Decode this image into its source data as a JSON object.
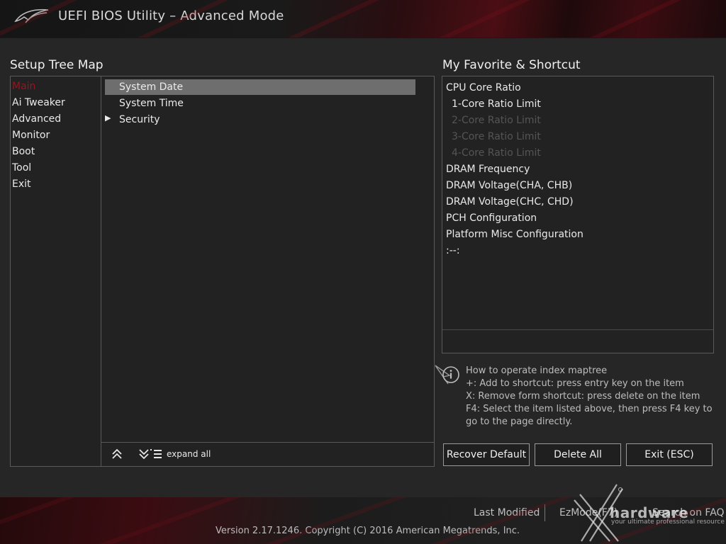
{
  "header": {
    "title": "UEFI BIOS Utility – Advanced Mode"
  },
  "tree": {
    "title": "Setup Tree Map",
    "menu": [
      {
        "label": "Main",
        "active": true
      },
      {
        "label": "Ai Tweaker"
      },
      {
        "label": "Advanced"
      },
      {
        "label": "Monitor"
      },
      {
        "label": "Boot"
      },
      {
        "label": "Tool"
      },
      {
        "label": "Exit"
      }
    ],
    "items": [
      {
        "label": "System Date",
        "selected": true
      },
      {
        "label": "System Time"
      },
      {
        "label": "Security",
        "expandable": true
      }
    ],
    "toolbar": {
      "expand_all": "expand all"
    }
  },
  "favorites": {
    "title": "My Favorite & Shortcut",
    "items": [
      {
        "label": "CPU Core Ratio"
      },
      {
        "label": "1-Core Ratio Limit",
        "sub": true
      },
      {
        "label": "2-Core Ratio Limit",
        "sub": true,
        "disabled": true
      },
      {
        "label": "3-Core Ratio Limit",
        "sub": true,
        "disabled": true
      },
      {
        "label": "4-Core Ratio Limit",
        "sub": true,
        "disabled": true
      },
      {
        "label": "DRAM Frequency"
      },
      {
        "label": "DRAM Voltage(CHA, CHB)"
      },
      {
        "label": "DRAM Voltage(CHC, CHD)"
      },
      {
        "label": "PCH Configuration"
      },
      {
        "label": "Platform Misc Configuration"
      },
      {
        "label": ":--:"
      }
    ]
  },
  "help": {
    "lines": [
      "How to operate index maptree",
      "+: Add to shortcut: press entry key on the item",
      "X: Remove form shortcut: press delete on the item",
      "F4: Select the item listed above, then press F4 key to",
      "go to the page directly."
    ]
  },
  "buttons": {
    "recover": "Recover Default",
    "delete_all": "Delete All",
    "exit": "Exit (ESC)"
  },
  "footer": {
    "last_modified": "Last Modified",
    "ez_mode": "EzMode(F7)",
    "search": "Search on FAQ",
    "version": "Version 2.17.1246. Copyright (C) 2016 American Megatrends, Inc."
  },
  "watermark": {
    "brand": "hardware",
    "tagline": "your ultimate professional resource"
  },
  "colors": {
    "accent": "#a0101e",
    "selected_row": "#6e6e6e",
    "disabled_text": "#555555"
  }
}
